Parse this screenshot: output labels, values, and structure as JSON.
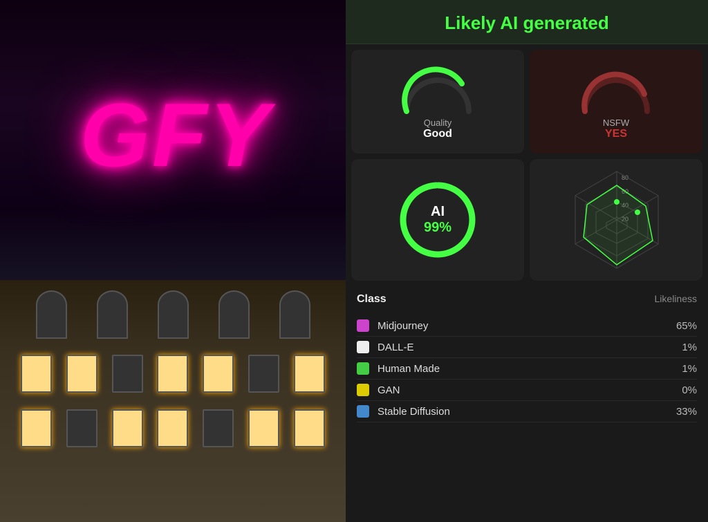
{
  "header": {
    "title": "Likely AI generated"
  },
  "quality_gauge": {
    "label": "Quality",
    "value": "Good",
    "percentage": 72,
    "color": "#44ff44",
    "bg_color": "#333"
  },
  "nsfw_gauge": {
    "label": "NSFW",
    "value": "YES",
    "percentage": 80,
    "color": "#993333",
    "bg_color": "#3a1010"
  },
  "ai_gauge": {
    "label": "AI",
    "percentage": 99,
    "percent_label": "99%",
    "color": "#44ff44",
    "bg_color": "#333"
  },
  "radar": {
    "scale_labels": [
      "80",
      "60",
      "40",
      "20"
    ],
    "color": "#44ff44"
  },
  "class_table": {
    "col1": "Class",
    "col2": "Likeliness",
    "rows": [
      {
        "name": "Midjourney",
        "color": "#cc44cc",
        "percent": "65%"
      },
      {
        "name": "DALL-E",
        "color": "#eeeeee",
        "percent": "1%"
      },
      {
        "name": "Human Made",
        "color": "#44cc44",
        "percent": "1%"
      },
      {
        "name": "GAN",
        "color": "#ddcc00",
        "percent": "0%"
      },
      {
        "name": "Stable Diffusion",
        "color": "#4488cc",
        "percent": "33%"
      }
    ]
  }
}
